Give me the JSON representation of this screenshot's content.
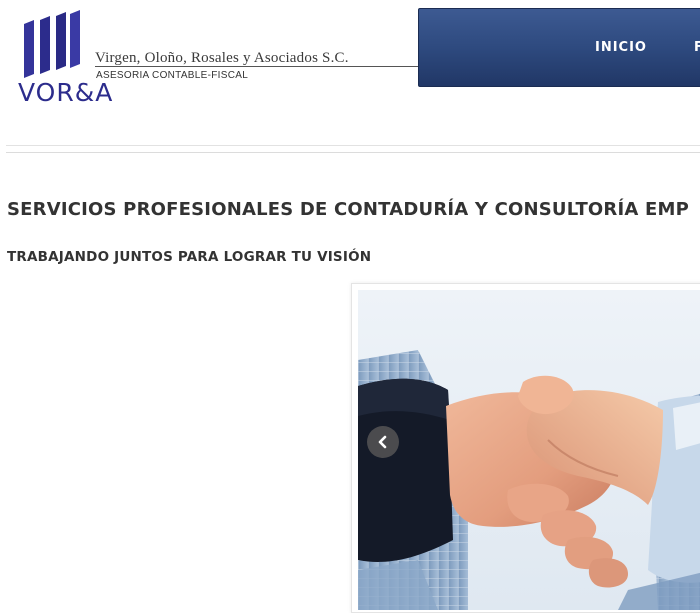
{
  "header": {
    "logo": {
      "abbr": "VOR&A",
      "icon": "vora-logo-icon",
      "color": "#2c2c8c"
    },
    "company_name": "Virgen, Oloño, Rosales y Asociados S.C.",
    "tagline": "ASESORIA CONTABLE-FISCAL",
    "nav": {
      "background": "#2e4a7f",
      "items": [
        {
          "label": "INICIO"
        },
        {
          "label": "F"
        }
      ]
    }
  },
  "main": {
    "title": "SERVICIOS PROFESIONALES DE CONTADURÍA Y CONSULTORÍA EMP",
    "subtitle": "TRABAJANDO JUNTOS PARA LOGRAR TU VISIÓN"
  },
  "slider": {
    "image": "handshake-photo",
    "prev_icon": "chevron-left-icon"
  }
}
